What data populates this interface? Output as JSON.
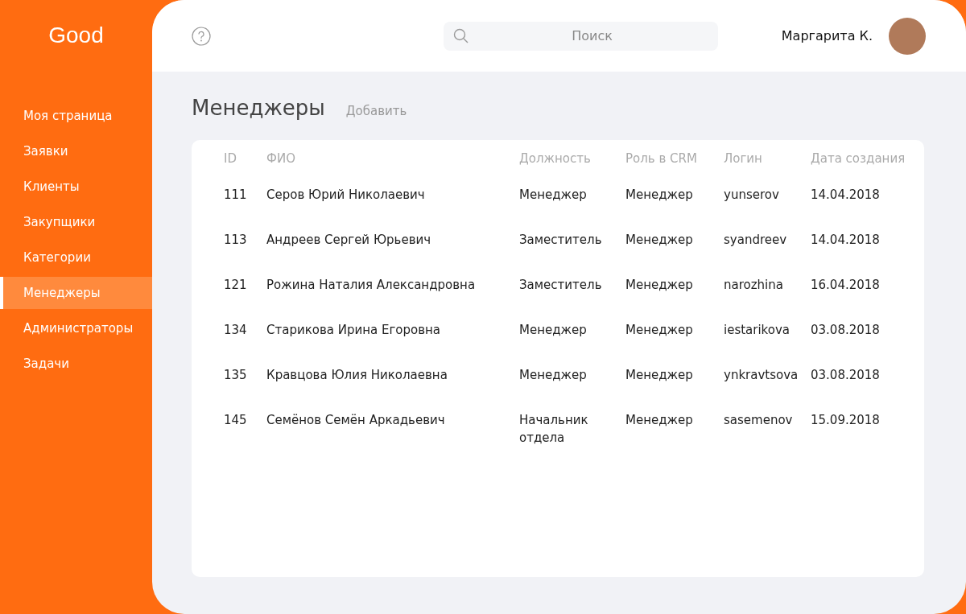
{
  "logo": "Good",
  "sidebar": {
    "items": [
      {
        "label": "Моя страница",
        "selected": false
      },
      {
        "label": "Заявки",
        "selected": false
      },
      {
        "label": "Клиенты",
        "selected": false
      },
      {
        "label": "Закупщики",
        "selected": false
      },
      {
        "label": "Категории",
        "selected": false
      },
      {
        "label": "Менеджеры",
        "selected": true
      },
      {
        "label": "Администраторы",
        "selected": false
      },
      {
        "label": "Задачи",
        "selected": false
      }
    ]
  },
  "search": {
    "placeholder": "Поиск"
  },
  "user": {
    "name": "Маргарита К."
  },
  "page": {
    "title": "Менеджеры",
    "action": "Добавить"
  },
  "table": {
    "columns": [
      "ID",
      "ФИО",
      "Должность",
      "Роль в CRM",
      "Логин",
      "Дата создания"
    ],
    "rows": [
      [
        "111",
        "Серов Юрий Николаевич",
        "Менеджер",
        "Менеджер",
        "yunserov",
        "14.04.2018"
      ],
      [
        "113",
        "Андреев Сергей Юрьевич",
        "Заместитель",
        "Менеджер",
        "syandreev",
        "14.04.2018"
      ],
      [
        "121",
        "Рожина Наталия Александровна",
        "Заместитель",
        "Менеджер",
        "narozhina",
        "16.04.2018"
      ],
      [
        "134",
        "Старикова Ирина Егоровна",
        "Менеджер",
        "Менеджер",
        "iestarikova",
        "03.08.2018"
      ],
      [
        "135",
        "Кравцова Юлия Николаевна",
        "Менеджер",
        "Менеджер",
        "ynkravtsova",
        "03.08.2018"
      ],
      [
        "145",
        "Семёнов Семён Аркадьевич",
        "Начальник отдела",
        "Менеджер",
        "sasemenov",
        "15.09.2018"
      ]
    ]
  }
}
